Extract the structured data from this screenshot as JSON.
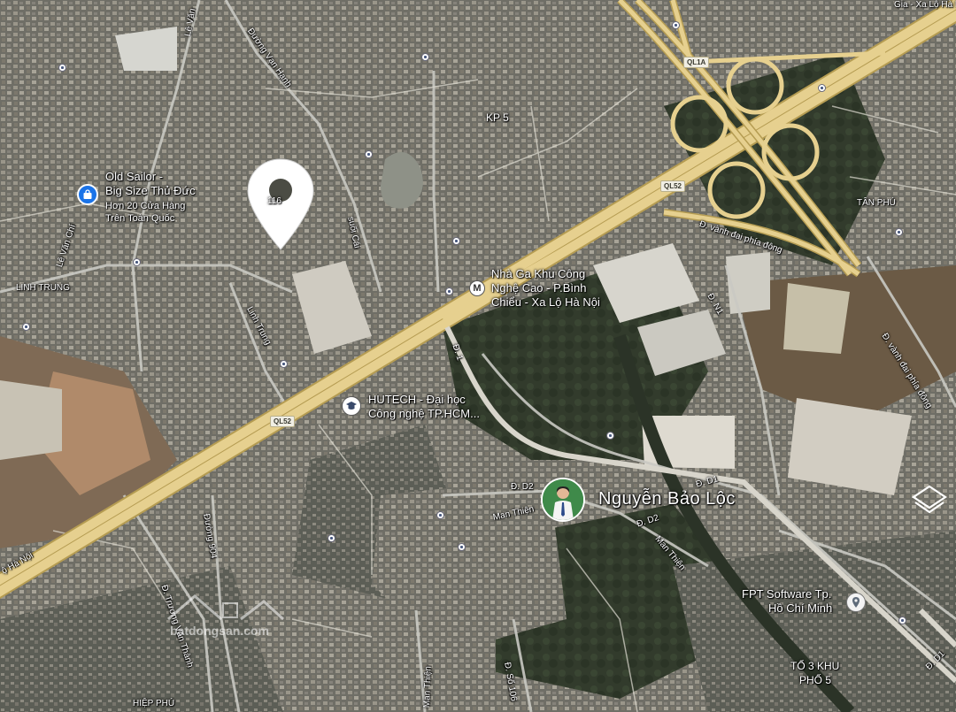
{
  "colors": {
    "highway": "#e6d08f",
    "highway_edge": "#b59c52",
    "road": "#c9c9c3",
    "imagery_dark": "#3f443c",
    "shopping_icon": "#1a73e8",
    "place_pin": "#ffffff"
  },
  "labels": {
    "old_sailor_1": "Old Sailor -",
    "old_sailor_2": "Big Size Thủ Đức",
    "old_sailor_3": "Hơn 20 Cửa Hàng",
    "old_sailor_4": "Trên Toàn Quốc",
    "pin_number": "116",
    "duong_van_hanh": "Đường Vạn Hạnh",
    "le_van_top": "Lê Văn",
    "le_van_chi": "Lê Văn Chí",
    "linh_trung_area": "LINH TRUNG",
    "linh_trung_street": "Linh Trung",
    "suoi_cai": "suối Cái",
    "kp5": "KP 5",
    "station_1": "Nhà Ga Khu Công",
    "station_2": "Nghệ Cao - P.Bình",
    "station_3": "Chiểu - Xa Lộ Hà Nội",
    "hutech_1": "HUTECH - Đại học",
    "hutech_2": "Công nghệ TP.HCM...",
    "vanh_dai_1": "Đ. vành đai phía đông",
    "vanh_dai_2": "Đ. vành đai phía đông",
    "tan_phu": "TÂN PHÚ",
    "d_n1": "Đ. N1",
    "d_1": "Đ. 1",
    "d_d1_mid": "Đ. D1",
    "d_d1_right": "Đ. D1",
    "d_d2_left": "Đ. D2",
    "d_d2_mid": "Đ. D2",
    "man_thien_1": "Man Thiện",
    "man_thien_2": "Man Thiện",
    "man_thien_3": "Man Thiện",
    "duong_904": "Đường 904",
    "truong_van_thanh": "Đ. Trương Văn Thành",
    "d_so_106": "Đ. Số 106",
    "fpt_1": "FPT Software Tp.",
    "fpt_2": "Hồ Chí Minh",
    "to3_1": "TỔ 3 KHU",
    "to3_2": "PHỐ 5",
    "hiep_phu": "HIỆP PHÚ",
    "ha_noi": "ộ Hà Nội",
    "top_right": "Gia - Xa Lộ Hà Nội",
    "user_name": "Nguyễn Bảo Lộc",
    "watermark": "batdongsan.com"
  },
  "badges": {
    "ql1a": "QL1A",
    "ql52_top": "QL52",
    "ql52_left": "QL52"
  },
  "icons": {
    "shopping": "shopping-bag-icon",
    "metro": "metro-station-icon",
    "school": "school-icon",
    "place": "place-pin-icon",
    "layers": "layers-icon",
    "avatar": "user-avatar"
  }
}
